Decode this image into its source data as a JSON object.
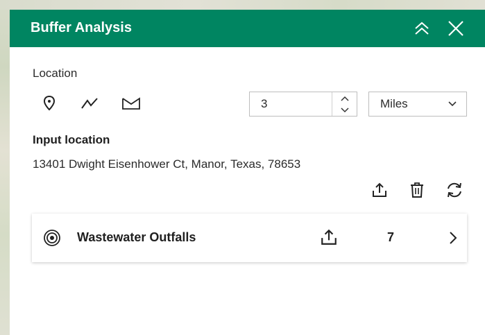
{
  "header": {
    "title": "Buffer Analysis",
    "collapse_icon": "double-chevron-up-icon",
    "close_icon": "close-icon",
    "bg_color": "#008561"
  },
  "location": {
    "label": "Location",
    "tools": [
      {
        "name": "point",
        "icon": "map-pin-icon"
      },
      {
        "name": "line",
        "icon": "polyline-icon"
      },
      {
        "name": "polygon",
        "icon": "polygon-icon"
      }
    ],
    "distance": {
      "value": "3"
    },
    "units": {
      "selected": "Miles"
    }
  },
  "input_location": {
    "title": "Input location",
    "address": "13401 Dwight Eisenhower Ct, Manor, Texas, 78653",
    "actions": [
      {
        "name": "export",
        "icon": "export-icon"
      },
      {
        "name": "delete",
        "icon": "trash-icon"
      },
      {
        "name": "refresh",
        "icon": "refresh-icon"
      }
    ]
  },
  "layers": [
    {
      "icon": "buffer-rings-icon",
      "name": "Wastewater Outfalls",
      "count": "7"
    }
  ]
}
